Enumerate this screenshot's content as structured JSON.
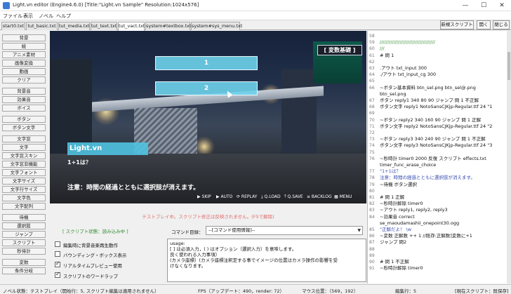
{
  "window": {
    "title": "Light.vn editor (Engine4.6.0) [Title:\"Light.vn Sample\" Resolution:1024x576]",
    "minimize": "—",
    "maximize": "☐",
    "close": "✕"
  },
  "menu": [
    "ファイル",
    "表示",
    "ノベル",
    "ヘルプ"
  ],
  "tabs": [
    "start0.txt",
    "tut_basic.txt",
    "tut_media.txt",
    "tut_text.txt",
    "tut_vact.txt",
    "system#textbox.txt",
    "system#sys_menu.txt"
  ],
  "active_tab": 4,
  "top_buttons": {
    "new_script": "新規スクリプト",
    "open": "開く",
    "close": "閉じる"
  },
  "left_buttons": [
    "背景",
    "絵",
    "アニメ素材",
    "画像変換",
    "動画",
    "クリア",
    "背景音",
    "効果音",
    "ボイス",
    "ボタン",
    "ボタン文字",
    "文字窓",
    "文字",
    "文字窓スキン",
    "文字窓非機能",
    "文字フォント",
    "文字サイズ",
    "文字行サイズ",
    "文字色",
    "文字配列",
    "待機",
    "選択肢",
    "ジャンプ",
    "スクリプト",
    "秒待計",
    "変数",
    "条件分岐"
  ],
  "game": {
    "variable_box": "[ 変数基礎 ]",
    "choice1": "1",
    "choice2": "2",
    "name": "Light.vn",
    "line1": "1+1は？",
    "line2": "注意：時間の経過とともに選択肢が消えます。",
    "quickmenu": [
      "▶ SKIP",
      "▶ AUTO",
      "⟳ REPLAY",
      "⤓ Q.LOAD",
      "⤒ Q.SAVE",
      "≡ BACKLOG",
      "▦ MENU"
    ]
  },
  "warning": "テストプレイ中。スクリプト修正は反映されません。(F5で解除)",
  "bottom": {
    "script_status": "[ スクリプト状態：読み込み中 ]",
    "checkboxes": [
      {
        "label": "編集時に背景音楽再生動作",
        "checked": false
      },
      {
        "label": "バウンディング・ボックス表示",
        "checked": false
      },
      {
        "label": "リアルタイムプレビュー使用",
        "checked": true
      },
      {
        "label": "スクリプトのワードラップ",
        "checked": true
      }
    ],
    "command_label": "コマンド目録：",
    "command_select": "--[コマンド使用情報]--",
    "usage": [
      "usage:",
      "[ ] は必須入力，( ) はオプション（選択入力）を意味します。",
      "良く使われる入力事項）",
      "(カメラ座標）(カメラ座標注釈定する事でイメージの位置はカメラ操作の影響を受",
      "けなくなります。"
    ]
  },
  "script": [
    {
      "n": "58",
      "t": "",
      "c": "#111"
    },
    {
      "n": "59",
      "t": "////////////////////////////////////",
      "c": "#2f8a2f"
    },
    {
      "n": "60",
      "t": "///",
      "c": "#2f8a2f"
    },
    {
      "n": "61",
      "t": "# 問 1",
      "c": "#111"
    },
    {
      "n": "62",
      "t": "",
      "c": "#111"
    },
    {
      "n": "63",
      "t": ".アウト txt_input 300",
      "c": "#111"
    },
    {
      "n": "64",
      "t": "./アウト txt_input_cg 300",
      "c": "#111"
    },
    {
      "n": "65",
      "t": "",
      "c": "#111"
    },
    {
      "n": "66",
      "t": "~ボタン基本資料 btn_sel.png btn_sel@.png",
      "c": "#111"
    },
    {
      "n": "",
      "t": "btn_sel.png",
      "c": "#111"
    },
    {
      "n": "67",
      "t": "ボタン reply1 340 80 90 ジャンプ 問 1 不正解",
      "c": "#111"
    },
    {
      "n": "68",
      "t": "ボタン文字 reply1 NotoSansCJKjp-Regular.ttf 24 \"1",
      "c": "#111"
    },
    {
      "n": "69",
      "t": "",
      "c": "#111"
    },
    {
      "n": "70",
      "t": "~ボタン reply2 340 160 90 ジャンプ 問 1 正解",
      "c": "#111"
    },
    {
      "n": "71",
      "t": "ボタン文字 reply2 NotoSansCJKjp-Regular.ttf 24 \"2",
      "c": "#111"
    },
    {
      "n": "72",
      "t": "",
      "c": "#111"
    },
    {
      "n": "73",
      "t": "~ボタン reply3 340 240 90 ジャンプ 問 1 不正解",
      "c": "#111"
    },
    {
      "n": "74",
      "t": "ボタン文字 reply3 NotoSansCJKjp-Regular.ttf 24 \"3",
      "c": "#111"
    },
    {
      "n": "75",
      "t": "",
      "c": "#111"
    },
    {
      "n": "76",
      "t": "~秒時計 timer0 2000 反復 スクリプト effects.txt",
      "c": "#111"
    },
    {
      "n": "",
      "t": "timer_func_erase_choice",
      "c": "#111"
    },
    {
      "n": "77",
      "t": "\"1+1は？",
      "c": "#3a4fb0"
    },
    {
      "n": "78",
      "t": "注意：時間の経過とともに選択肢が消えます。",
      "c": "#3a4fb0"
    },
    {
      "n": "79",
      "t": "~待機 ボタン選択",
      "c": "#111"
    },
    {
      "n": "80",
      "t": "",
      "c": "#111"
    },
    {
      "n": "81",
      "t": "# 問 1 正解",
      "c": "#111"
    },
    {
      "n": "82",
      "t": "~秒時計解除 timer0",
      "c": "#111"
    },
    {
      "n": "83",
      "t": "~アウト reply1, reply2, reply3",
      "c": "#111"
    },
    {
      "n": "84",
      "t": "~効果音 correct",
      "c": "#111"
    },
    {
      "n": "",
      "t": "se_maoudamashii_onepoint30.ogg",
      "c": "#111"
    },
    {
      "n": "85",
      "t": "\"正解だよ！ \\w",
      "c": "#3a4fb0"
    },
    {
      "n": "86",
      "t": "~変数 正解数 ++ 1 //既存:正解数]変数に+1",
      "c": "#111"
    },
    {
      "n": "87",
      "t": "ジャンプ 問2",
      "c": "#111"
    },
    {
      "n": "88",
      "t": "",
      "c": "#111"
    },
    {
      "n": "89",
      "t": "",
      "c": "#111"
    },
    {
      "n": "90",
      "t": "# 問 1 不正解",
      "c": "#111"
    },
    {
      "n": "91",
      "t": "~秒時計解除 timer0",
      "c": "#111"
    }
  ],
  "statusbar": {
    "left": "ノベル状態：テストプレイ（開始行：5, スクリプト編集は適用されません）",
    "fps": "FPS（アップデート：490，render: 72）",
    "mouse": "マウス位置：（569，192）",
    "lines": "編集行：5",
    "current": "[現在スクリプト：既保存]"
  }
}
